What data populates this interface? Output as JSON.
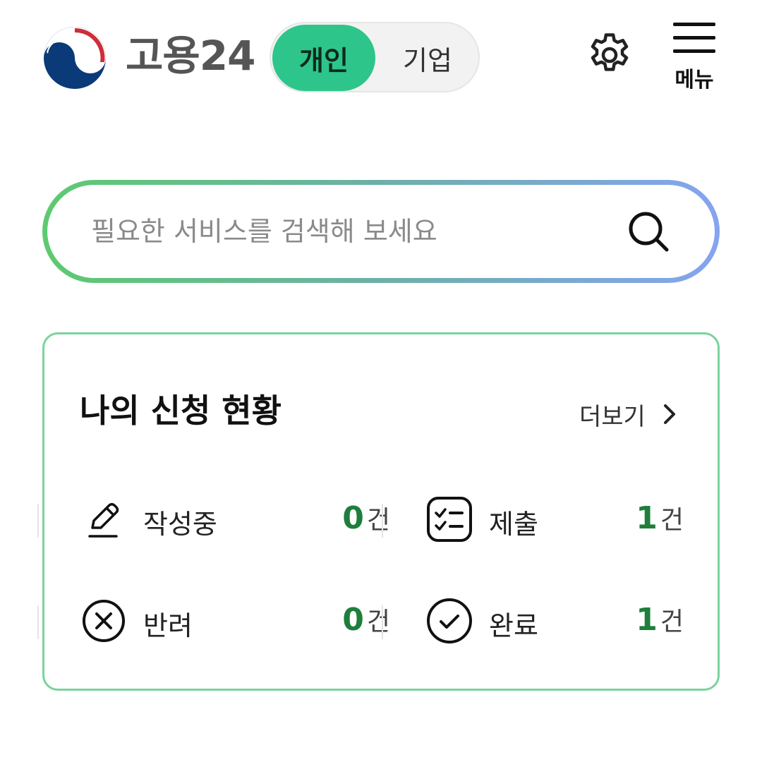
{
  "header": {
    "logo_text": "고용24",
    "toggle": {
      "personal_label": "개인",
      "business_label": "기업",
      "selected": "개인"
    },
    "settings_icon": "gear-icon",
    "menu_label": "메뉴"
  },
  "search": {
    "placeholder": "필요한 서비스를 검색해 보세요",
    "value": "",
    "icon": "search-icon"
  },
  "status_card": {
    "title": "나의 신청 현황",
    "more_label": "더보기",
    "items": [
      {
        "label": "작성중",
        "count": "0",
        "unit": "건",
        "icon": "pencil-icon"
      },
      {
        "label": "제출",
        "count": "1",
        "unit": "건",
        "icon": "checklist-icon"
      },
      {
        "label": "반려",
        "count": "0",
        "unit": "건",
        "icon": "x-circle-icon"
      },
      {
        "label": "완료",
        "count": "1",
        "unit": "건",
        "icon": "check-circle-icon"
      }
    ]
  },
  "colors": {
    "accent_green": "#2ec58a",
    "count_green": "#1e7e3c",
    "card_border": "#79d49c",
    "search_gradient_start": "#5dca70",
    "search_gradient_end": "#85a4f0"
  }
}
